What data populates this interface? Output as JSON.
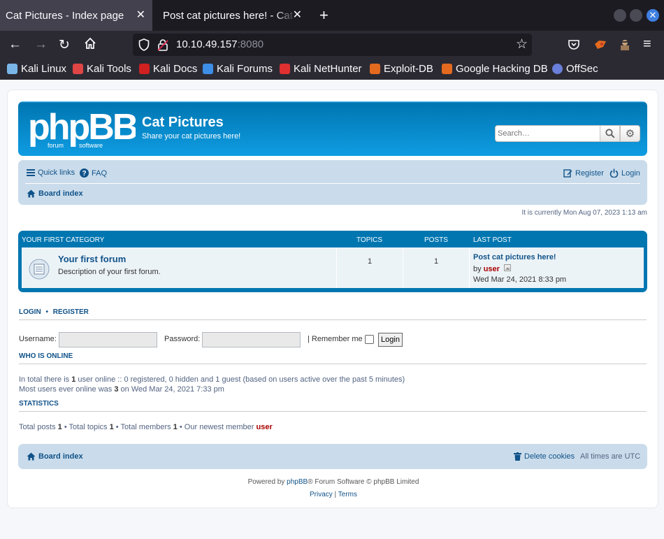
{
  "browser": {
    "tabs": [
      {
        "title": "Cat Pictures - Index page",
        "active": true
      },
      {
        "title": "Post cat pictures here! - Cat Pictures",
        "active": false
      }
    ],
    "url_host": "10.10.49.157",
    "url_port": ":8080",
    "bookmarks": [
      {
        "label": "Kali Linux",
        "color": "#7ab6e8"
      },
      {
        "label": "Kali Tools",
        "color": "#e04545"
      },
      {
        "label": "Kali Docs",
        "color": "#d02020"
      },
      {
        "label": "Kali Forums",
        "color": "#3d8ee6"
      },
      {
        "label": "Kali NetHunter",
        "color": "#e03030"
      },
      {
        "label": "Exploit-DB",
        "color": "#e36a1e"
      },
      {
        "label": "Google Hacking DB",
        "color": "#e36a1e"
      },
      {
        "label": "OffSec",
        "color": "#6a7fd9"
      }
    ]
  },
  "forum": {
    "logo_text": "phpBB",
    "logo_sub_left": "forum",
    "logo_sub_right": "software",
    "site_title": "Cat Pictures",
    "site_desc": "Share your cat pictures here!",
    "search_placeholder": "Search…",
    "quick_links": "Quick links",
    "faq": "FAQ",
    "register": "Register",
    "login": "Login",
    "board_index": "Board index",
    "current_time": "It is currently Mon Aug 07, 2023 1:13 am",
    "category": {
      "name": "YOUR FIRST CATEGORY",
      "col_topics": "TOPICS",
      "col_posts": "POSTS",
      "col_last_post": "LAST POST"
    },
    "row": {
      "name": "Your first forum",
      "desc": "Description of your first forum.",
      "topics": "1",
      "posts": "1",
      "last_post_title": "Post cat pictures here!",
      "last_post_by": "by",
      "last_post_user": "user",
      "last_post_date": "Wed Mar 24, 2021 8:33 pm"
    },
    "login_section": {
      "login_header": "LOGIN",
      "sep": "•",
      "register_header": "REGISTER",
      "username_label": "Username:",
      "password_label": "Password:",
      "remember_label": "| Remember me",
      "login_button": "Login"
    },
    "online": {
      "header": "WHO IS ONLINE",
      "l1_a": "In total there is ",
      "l1_b": "1",
      "l1_c": " user online :: 0 registered, 0 hidden and 1 guest (based on users active over the past 5 minutes)",
      "l2_a": "Most users ever online was ",
      "l2_b": "3",
      "l2_c": " on Wed Mar 24, 2021 7:33 pm"
    },
    "stats": {
      "header": "STATISTICS",
      "a": "Total posts ",
      "b": "1",
      "c": " • Total topics ",
      "d": "1",
      "e": " • Total members ",
      "f": "1",
      "g": " • Our newest member ",
      "user": "user"
    },
    "footer": {
      "board_index": "Board index",
      "delete_cookies": "Delete cookies",
      "times": "All times are UTC",
      "powered_a": "Powered by ",
      "powered_link": "phpBB",
      "powered_b": "® Forum Software © phpBB Limited",
      "privacy": "Privacy",
      "pipe": " | ",
      "terms": "Terms"
    }
  }
}
